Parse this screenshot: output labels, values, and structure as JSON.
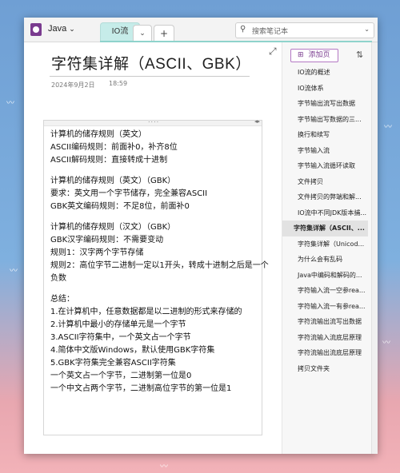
{
  "app": {
    "notebook_name": "Java",
    "active_tab": "IO流",
    "search_placeholder": "搜索笔记本"
  },
  "note": {
    "title": "字符集详解（ASCII、GBK）",
    "date": "2024年9月2日",
    "time": "18:59",
    "lines": [
      "计算机的储存规则（英文）",
      "ASCII编码规则：前面补0，补齐8位",
      "ASCII解码规则：直接转成十进制",
      "",
      "计算机的储存规则（英文）（GBK）",
      "要求：英文用一个字节储存，完全兼容ASCII",
      "GBK英文编码规则：不足8位，前面补0",
      "",
      "计算机的储存规则（汉文）（GBK）",
      "GBK汉字编码规则：不需要变动",
      "规则1：汉字两个字节存储",
      "规则2：高位字节二进制一定以1开头，转成十进制之后是一个",
      "负数",
      "",
      "总结：",
      "1.在计算机中，任意数据都是以二进制的形式来存储的",
      "2.计算机中最小的存储单元是一个字节",
      "3.ASCII字符集中，一个英文占一个字节",
      "4.简体中文版Windows，默认使用GBK字符集",
      "5.GBK字符集完全兼容ASCII字符集",
      "一个英文占一个字节，二进制第一位是0",
      "一个中文占两个字节，二进制高位字节的第一位是1"
    ]
  },
  "sidebar": {
    "add_page_label": "添加页",
    "pages": [
      "IO流的概述",
      "IO流体系",
      "字节输出流写出数据",
      "字节输出写数据的三...",
      "换行和续写",
      "字节输入流",
      "字节输入流循环读取",
      "文件拷贝",
      "文件拷贝的弊端和解...",
      "IO流中不同JDK版本捕...",
      "字符集详解（ASCII、...",
      "字符集详解（Unicod...",
      "为什么会有乱码",
      "Java中编码和解码的...",
      "字符输入流一空参rea...",
      "字符输入流一有参rea...",
      "字符流输出流写出数据",
      "字符流输入流底层原理",
      "字符流输出流底层原理",
      "拷贝文件夹"
    ],
    "selected_index": 10
  },
  "icons": {
    "app": "onenote-icon",
    "search": "search-icon",
    "expand": "expand-icon",
    "sort": "sort-icon",
    "add": "plus-icon"
  },
  "colors": {
    "tab_accent": "#c6ece9",
    "brand": "#7a3b8f"
  }
}
